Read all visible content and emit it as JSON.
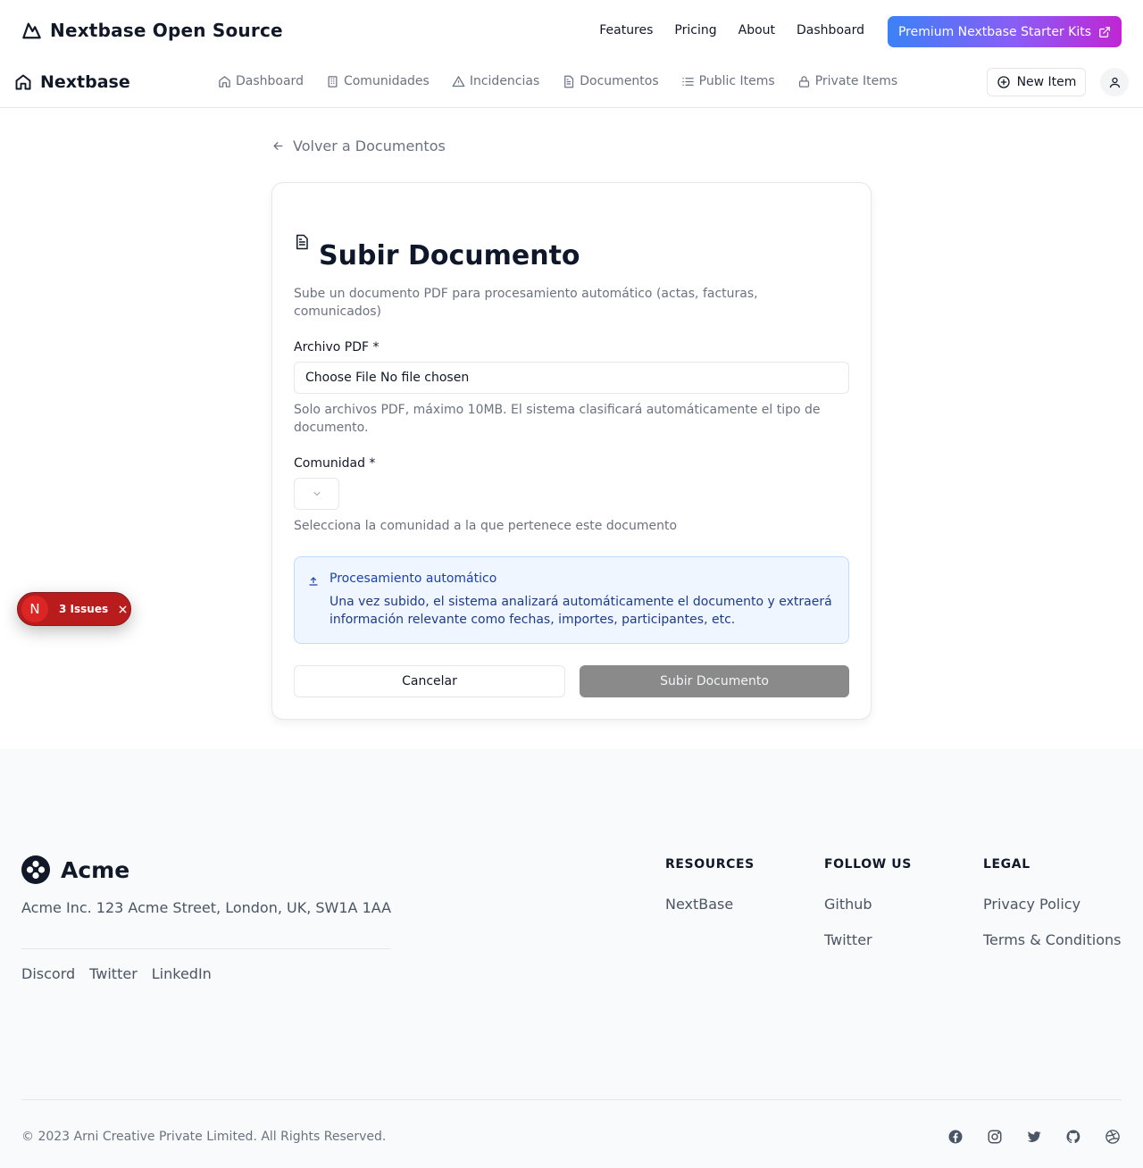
{
  "topbar": {
    "brand": "Nextbase Open Source",
    "nav": [
      "Features",
      "Pricing",
      "About",
      "Dashboard"
    ],
    "premium_label": "Premium Nextbase Starter Kits"
  },
  "appbar": {
    "brand": "Nextbase",
    "nav": [
      {
        "label": "Dashboard",
        "icon": "home-icon"
      },
      {
        "label": "Comunidades",
        "icon": "building-icon"
      },
      {
        "label": "Incidencias",
        "icon": "alert-triangle-icon"
      },
      {
        "label": "Documentos",
        "icon": "file-text-icon"
      },
      {
        "label": "Public Items",
        "icon": "list-icon"
      },
      {
        "label": "Private Items",
        "icon": "lock-icon"
      }
    ],
    "new_item_label": "New Item"
  },
  "main": {
    "back_label": "Volver a Documentos",
    "card": {
      "title": "Subir Documento",
      "description": "Sube un documento PDF para procesamiento automático (actas, facturas, comunicados)",
      "file_label": "Archivo PDF *",
      "file_input_text": "Choose File No file chosen",
      "file_hint": "Solo archivos PDF, máximo 10MB. El sistema clasificará automáticamente el tipo de documento.",
      "community_label": "Comunidad *",
      "community_hint": "Selecciona la comunidad a la que pertenece este documento",
      "info_title": "Procesamiento automático",
      "info_text": "Una vez subido, el sistema analizará automáticamente el documento y extraerá información relevante como fechas, importes, participantes, etc.",
      "cancel_label": "Cancelar",
      "submit_label": "Subir Documento"
    }
  },
  "issues_badge": {
    "letter": "N",
    "label": "3 Issues"
  },
  "footer": {
    "brand": "Acme",
    "address": "Acme Inc. 123 Acme Street, London, UK, SW1A 1AA",
    "social_links": [
      "Discord",
      "Twitter",
      "LinkedIn"
    ],
    "columns": [
      {
        "heading": "RESOURCES",
        "links": [
          "NextBase"
        ]
      },
      {
        "heading": "FOLLOW US",
        "links": [
          "Github",
          "Twitter"
        ]
      },
      {
        "heading": "LEGAL",
        "links": [
          "Privacy Policy",
          "Terms & Conditions"
        ]
      }
    ],
    "copyright": "© 2023 Arni Creative Private Limited. All Rights Reserved.",
    "icons": [
      "facebook-icon",
      "instagram-icon",
      "twitter-icon",
      "github-icon",
      "dribbble-icon"
    ]
  },
  "colors": {
    "accent_gradient_start": "#3b82f6",
    "accent_gradient_end": "#c026d3",
    "info_bg": "#eff6ff",
    "info_text": "#1e3a8a",
    "issues_red": "#b91c1c",
    "submit_disabled": "#8a8a8a"
  }
}
